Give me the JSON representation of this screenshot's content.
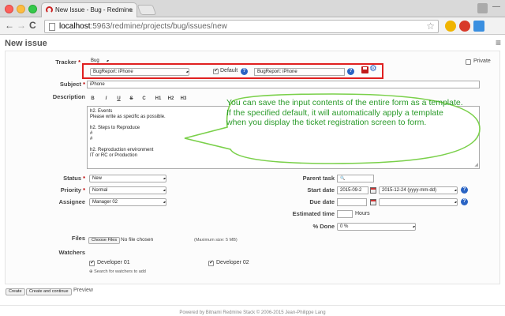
{
  "browser": {
    "tab_title": "New Issue - Bug - Redmine",
    "tab_close": "×",
    "url_host": "localhost",
    "url_path": ":5963/redmine/projects/bug/issues/new",
    "back": "←",
    "forward": "→",
    "reload": "C",
    "star": "☆",
    "menu": "≡",
    "minimize": "—"
  },
  "page": {
    "title": "New issue"
  },
  "form": {
    "tracker": {
      "label": "Tracker",
      "required_mark": "*",
      "value": "Bug"
    },
    "private": {
      "label": "Private",
      "checked": false
    },
    "template": {
      "select_value": "BugReport: iPhone",
      "default_label": "Default",
      "default_checked": true,
      "name_value": "BugReport: iPhone",
      "help_icon": "?"
    },
    "subject": {
      "label": "Subject",
      "required_mark": "*",
      "value": "iPhone"
    },
    "description": {
      "label": "Description",
      "toolbar": [
        "B",
        "I",
        "U",
        "S",
        "C",
        "H1",
        "H2",
        "H3"
      ],
      "lines": [
        "h2. Events",
        "Please write as specific as possible.",
        "",
        "h2. Steps to Reproduce",
        "#",
        "#",
        "",
        "h2. Reproduction environment",
        "IT or RC or Production"
      ]
    },
    "status": {
      "label": "Status",
      "required_mark": "*",
      "value": "New"
    },
    "priority": {
      "label": "Priority",
      "required_mark": "*",
      "value": "Normal"
    },
    "assignee": {
      "label": "Assignee",
      "value": "Manager 02"
    },
    "parent_task": {
      "label": "Parent task",
      "icon": "🔍",
      "value": ""
    },
    "start_date": {
      "label": "Start date",
      "value": "2015-09-2",
      "select_value": "2015-12-24 (yyyy-mm-dd)"
    },
    "due_date": {
      "label": "Due date",
      "value": ""
    },
    "estimated_time": {
      "label": "Estimated time",
      "value": "",
      "unit": "Hours"
    },
    "done": {
      "label": "% Done",
      "value": "0 %"
    },
    "files": {
      "label": "Files",
      "button": "Choose Files",
      "status": "No file chosen",
      "max_size": "(Maximum size: 5 MB)"
    },
    "watchers": {
      "label": "Watchers",
      "items": [
        {
          "name": "Developer 01",
          "checked": true
        },
        {
          "name": "Developer 02",
          "checked": true
        }
      ],
      "search_link": "Search for watchers to add"
    }
  },
  "buttons": {
    "create": "Create",
    "create_continue": "Create and continue",
    "preview": "Preview"
  },
  "callout": {
    "text": "You can save the input contents of the entire form as a template. If the specified default, it will automatically apply a template when you display the ticket registration screen to form.",
    "color": "#2a9a2a"
  },
  "footer": {
    "text": "Powered by Bitnami Redmine Stack © 2006-2015 Jean-Philippe Lang"
  },
  "colors": {
    "highlight_border": "#e02020",
    "required": "#bb0000",
    "help_icon": "#2a64c4"
  }
}
